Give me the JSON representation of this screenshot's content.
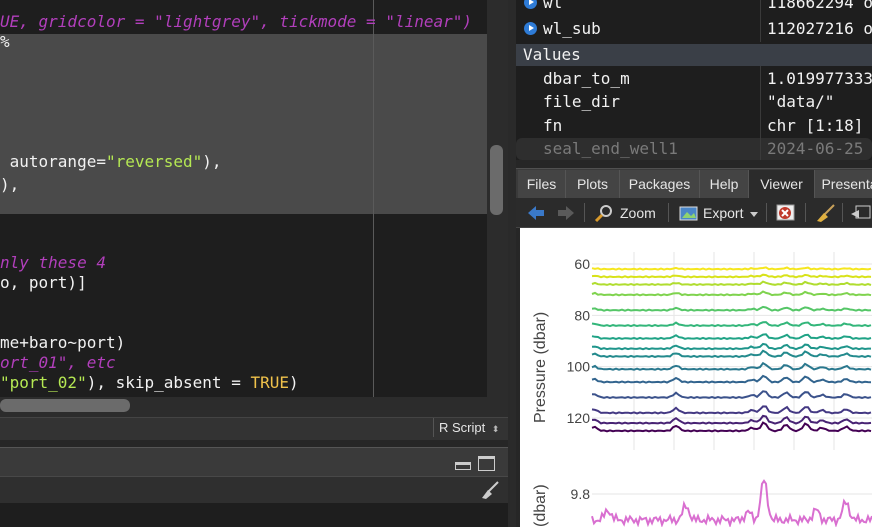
{
  "editor": {
    "lines": [
      {
        "parts": [
          {
            "t": "UE, gridcolor = \"lightgrey\", tickmode = \"linear\")",
            "c": "it"
          }
        ]
      },
      {
        "parts": [
          {
            "t": "%",
            "c": ""
          }
        ]
      },
      {
        "parts": [
          {
            "t": " autorange=",
            "c": ""
          },
          {
            "t": "\"reversed\"",
            "c": "str"
          },
          {
            "t": "),",
            "c": ""
          }
        ]
      },
      {
        "parts": [
          {
            "t": "),",
            "c": ""
          }
        ]
      },
      {
        "parts": [
          {
            "t": "nly these 4",
            "c": "it"
          }
        ]
      },
      {
        "parts": [
          {
            "t": "o, port)]",
            "c": ""
          }
        ]
      },
      {
        "parts": [
          {
            "t": "me+baro~port)",
            "c": ""
          }
        ]
      },
      {
        "parts": [
          {
            "t": "ort_01\", etc",
            "c": "it"
          }
        ]
      },
      {
        "parts": [
          {
            "t": "\"port_02\"",
            "c": "str"
          },
          {
            "t": "), skip_absent = ",
            "c": ""
          },
          {
            "t": "TRUE",
            "c": "kw"
          },
          {
            "t": ")",
            "c": ""
          }
        ]
      }
    ],
    "language": "R Script"
  },
  "environment": {
    "rows": [
      {
        "name": "wl",
        "value": "118662294 o"
      },
      {
        "name": "wl_sub",
        "value": "112027216 o"
      }
    ],
    "values_header": "Values",
    "values": [
      {
        "name": "dbar_to_m",
        "value": "1.019977333"
      },
      {
        "name": "file_dir",
        "value": "\"data/\""
      },
      {
        "name": "fn",
        "value": "chr [1:18]"
      },
      {
        "name": "seal_end_well1",
        "value": "2024-06-25"
      }
    ]
  },
  "tabs": [
    "Files",
    "Plots",
    "Packages",
    "Help",
    "Viewer",
    "Presenta"
  ],
  "active_tab": "Viewer",
  "toolbar": {
    "zoom": "Zoom",
    "export": "Export"
  },
  "chart_data": [
    {
      "type": "line",
      "ylabel": "Pressure (dbar)",
      "yticks": [
        60,
        80,
        100,
        120
      ],
      "ylim": [
        130,
        55
      ],
      "reversed_y": true,
      "series_levels": [
        62,
        65,
        68,
        72,
        78,
        84,
        89,
        93,
        96,
        101,
        106,
        112,
        118,
        122,
        125
      ],
      "colors": [
        "#f5e61f",
        "#d8e219",
        "#b0dd2f",
        "#7fd34e",
        "#55c667",
        "#33b67a",
        "#20a386",
        "#1f958b",
        "#238a8d",
        "#2a788e",
        "#32648e",
        "#3b528b",
        "#443983",
        "#482374",
        "#440154"
      ]
    },
    {
      "type": "line",
      "ylabel": "(dbar)",
      "yticks": [
        9.8
      ],
      "color": "#d96fd0"
    }
  ]
}
